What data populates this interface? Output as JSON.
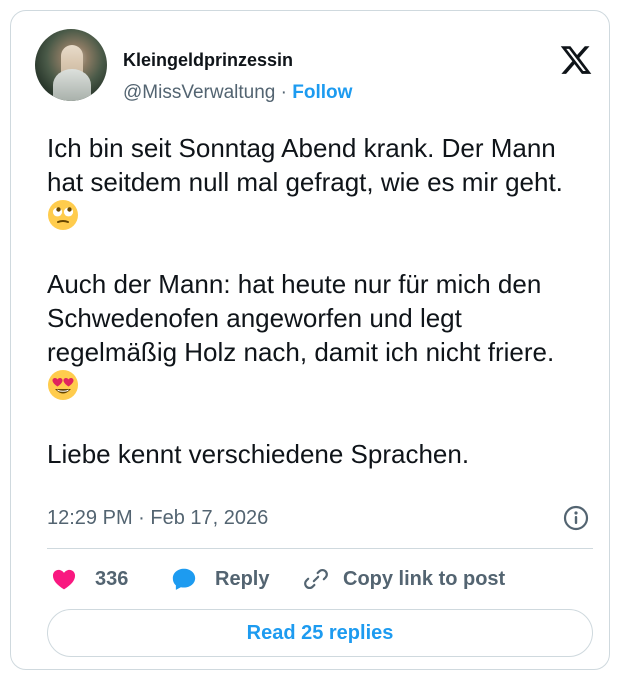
{
  "author": {
    "display_name": "Kleingeldprinzessin",
    "handle": "@MissVerwaltung",
    "separator": " · ",
    "follow_label": "Follow"
  },
  "tweet": {
    "paragraph1": "Ich bin seit Sonntag Abend krank. Der Mann hat seitdem null mal gefragt, wie es mir geht.",
    "paragraph2": "Auch der Mann: hat heute nur für mich den Schwedenofen angeworfen und legt regelmäßig Holz nach, damit ich nicht friere.",
    "paragraph3": "Liebe kennt verschiedene Sprachen.",
    "emoji1": "face-with-rolling-eyes",
    "emoji2": "smiling-face-with-heart-eyes"
  },
  "timestamp": "12:29 PM · Feb 17, 2026",
  "actions": {
    "like_count": "336",
    "reply_label": "Reply",
    "copy_label": "Copy link to post"
  },
  "read_replies_label": "Read 25 replies",
  "colors": {
    "accent": "#1d9bf0",
    "like": "#f91880",
    "text": "#0f1419",
    "secondary": "#536471",
    "border": "#cfd9de"
  },
  "icons": [
    "x-logo-icon",
    "info-icon",
    "heart-icon",
    "reply-bubble-icon",
    "link-icon"
  ]
}
